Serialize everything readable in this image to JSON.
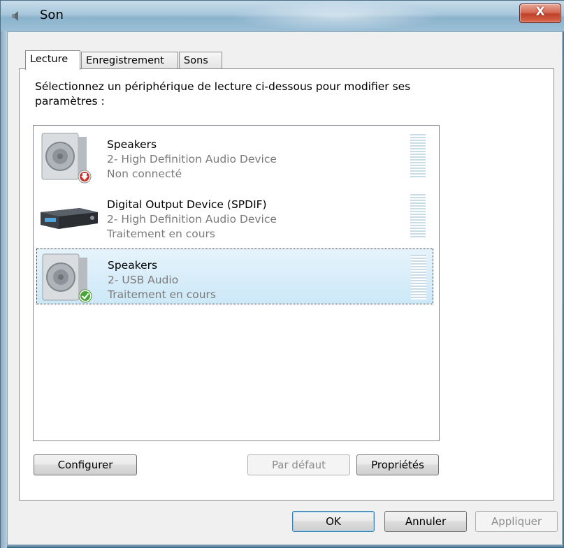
{
  "window": {
    "title": "Son",
    "close_glyph": "X"
  },
  "tabs": [
    {
      "label": "Lecture",
      "active": true
    },
    {
      "label": "Enregistrement",
      "active": false
    },
    {
      "label": "Sons",
      "active": false
    }
  ],
  "instruction": "Sélectionnez un périphérique de lecture ci-dessous pour modifier ses paramètres :",
  "devices": [
    {
      "name": "Speakers",
      "description": "2- High Definition Audio Device",
      "status": "Non connecté",
      "icon": "speaker-icon",
      "badge": "disconnected-badge-icon",
      "selected": false
    },
    {
      "name": "Digital Output Device (SPDIF)",
      "description": "2- High Definition Audio Device",
      "status": "Traitement en cours",
      "icon": "digital-receiver-icon",
      "badge": null,
      "selected": false
    },
    {
      "name": "Speakers",
      "description": "2- USB Audio",
      "status": "Traitement en cours",
      "icon": "speaker-icon",
      "badge": "default-check-badge-icon",
      "selected": true
    }
  ],
  "panel_buttons": {
    "configure": "Configurer",
    "set_default": "Par défaut",
    "properties": "Propriétés"
  },
  "dialog_buttons": {
    "ok": "OK",
    "cancel": "Annuler",
    "apply": "Appliquer"
  },
  "colors": {
    "selection": "#cce8f7",
    "close_button": "#c0412a",
    "meter": "#c9dbe7"
  }
}
